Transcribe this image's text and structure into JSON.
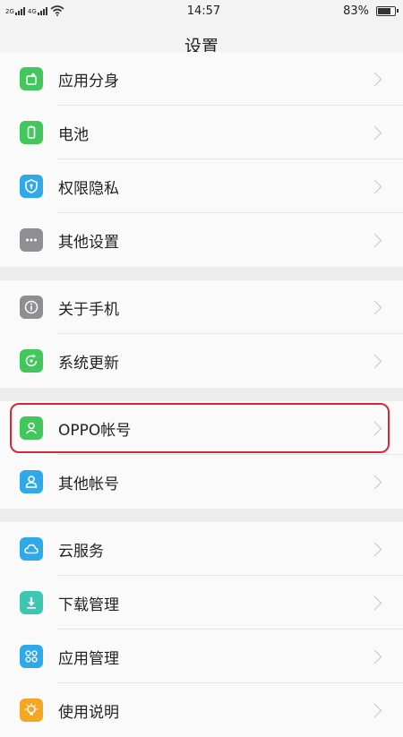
{
  "status": {
    "network_label_1": "2G",
    "network_label_2": "4G",
    "time": "14:57",
    "battery_text": "83%",
    "battery_level": 0.83
  },
  "header": {
    "title": "设置"
  },
  "groups": [
    {
      "items": [
        {
          "label": "应用分身",
          "icon": "app-clone-icon",
          "color": "#41c75b"
        },
        {
          "label": "电池",
          "icon": "battery-icon",
          "color": "#41c75b"
        },
        {
          "label": "权限隐私",
          "icon": "shield-icon",
          "color": "#2ea9ea"
        },
        {
          "label": "其他设置",
          "icon": "more-dots-icon",
          "color": "#8e8e93"
        }
      ]
    },
    {
      "items": [
        {
          "label": "关于手机",
          "icon": "info-icon",
          "color": "#8e8e93"
        },
        {
          "label": "系统更新",
          "icon": "update-icon",
          "color": "#41c75b"
        }
      ]
    },
    {
      "items": [
        {
          "label": "OPPO帐号",
          "icon": "user-icon",
          "color": "#41c75b"
        },
        {
          "label": "其他帐号",
          "icon": "user-outline-icon",
          "color": "#2ea9ea"
        }
      ]
    },
    {
      "items": [
        {
          "label": "云服务",
          "icon": "cloud-icon",
          "color": "#2ea9ea"
        },
        {
          "label": "下载管理",
          "icon": "download-icon",
          "color": "#3cc8b0"
        },
        {
          "label": "应用管理",
          "icon": "apps-grid-icon",
          "color": "#2ea9ea"
        },
        {
          "label": "使用说明",
          "icon": "bulb-icon",
          "color": "#f5a623"
        }
      ]
    }
  ]
}
